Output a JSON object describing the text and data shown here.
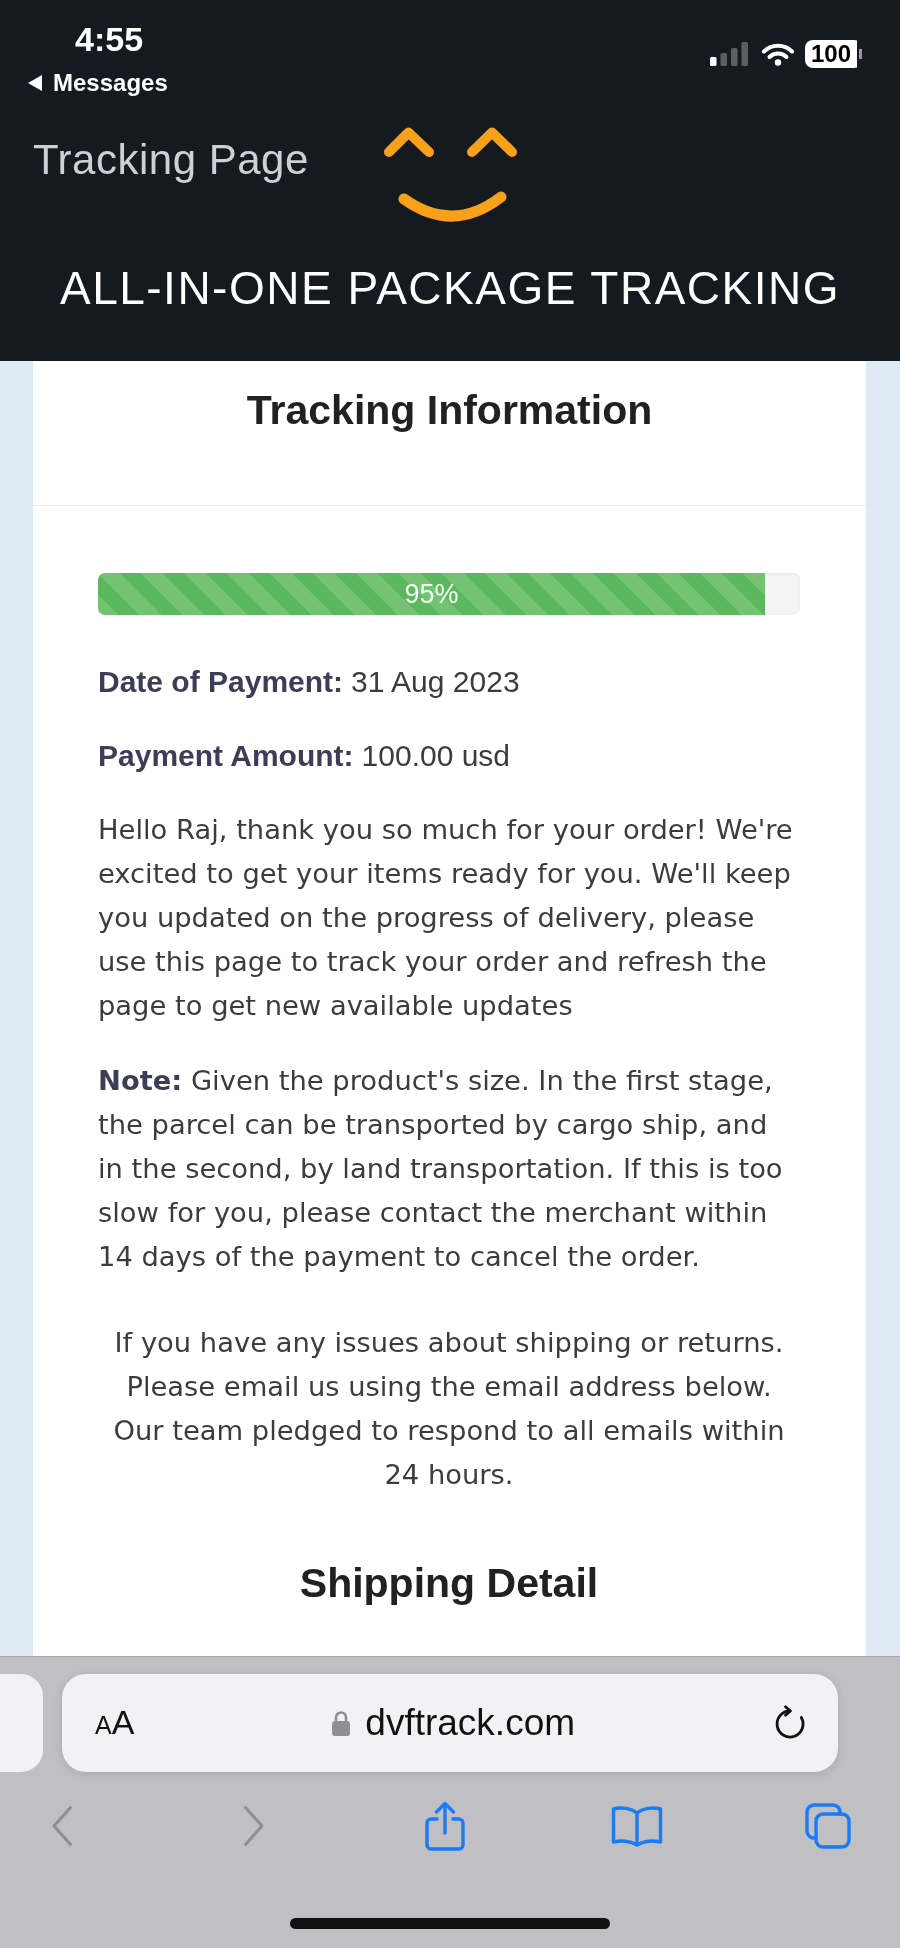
{
  "status_bar": {
    "time": "4:55",
    "back_label": "Messages",
    "battery": "100"
  },
  "header": {
    "title": "Tracking Page",
    "tagline": "ALL-IN-ONE PACKAGE TRACKING"
  },
  "card": {
    "title": "Tracking Information",
    "progress": {
      "level": 0.95,
      "label": "95%"
    },
    "fields": [
      {
        "label": "Date of Payment:",
        "value": "31 Aug 2023"
      },
      {
        "label": "Payment Amount:",
        "value": "100.00 usd"
      }
    ],
    "paragraphs": [
      {
        "kind": "left",
        "text": "Hello Raj, thank you so much for your order! We're excited to get your items ready for you. We'll keep you updated on the progress of delivery, please use this page to track your order and refresh the page to get new available updates"
      },
      {
        "kind": "left",
        "text": "**Note:** Given the product's size. In the first stage, the parcel can be transported by cargo ship, and in the second, by land transportation. If this is too slow for you, please contact the merchant within 14 days of the payment to cancel the order."
      },
      {
        "kind": "centered",
        "text": "If you have any issues about shipping or returns. Please email us using the email address below. Our team pledged to respond to all emails within 24 hours."
      }
    ],
    "section_title": "Shipping Detail"
  },
  "browser": {
    "text_size": "AA",
    "url": "dvftrack.com",
    "toolbar": [
      {
        "kind": "back",
        "disabled": true
      },
      {
        "kind": "forward",
        "disabled": true
      },
      {
        "kind": "share",
        "disabled": false
      },
      {
        "kind": "bookmarks",
        "disabled": false
      },
      {
        "kind": "tabs",
        "disabled": false
      }
    ]
  }
}
